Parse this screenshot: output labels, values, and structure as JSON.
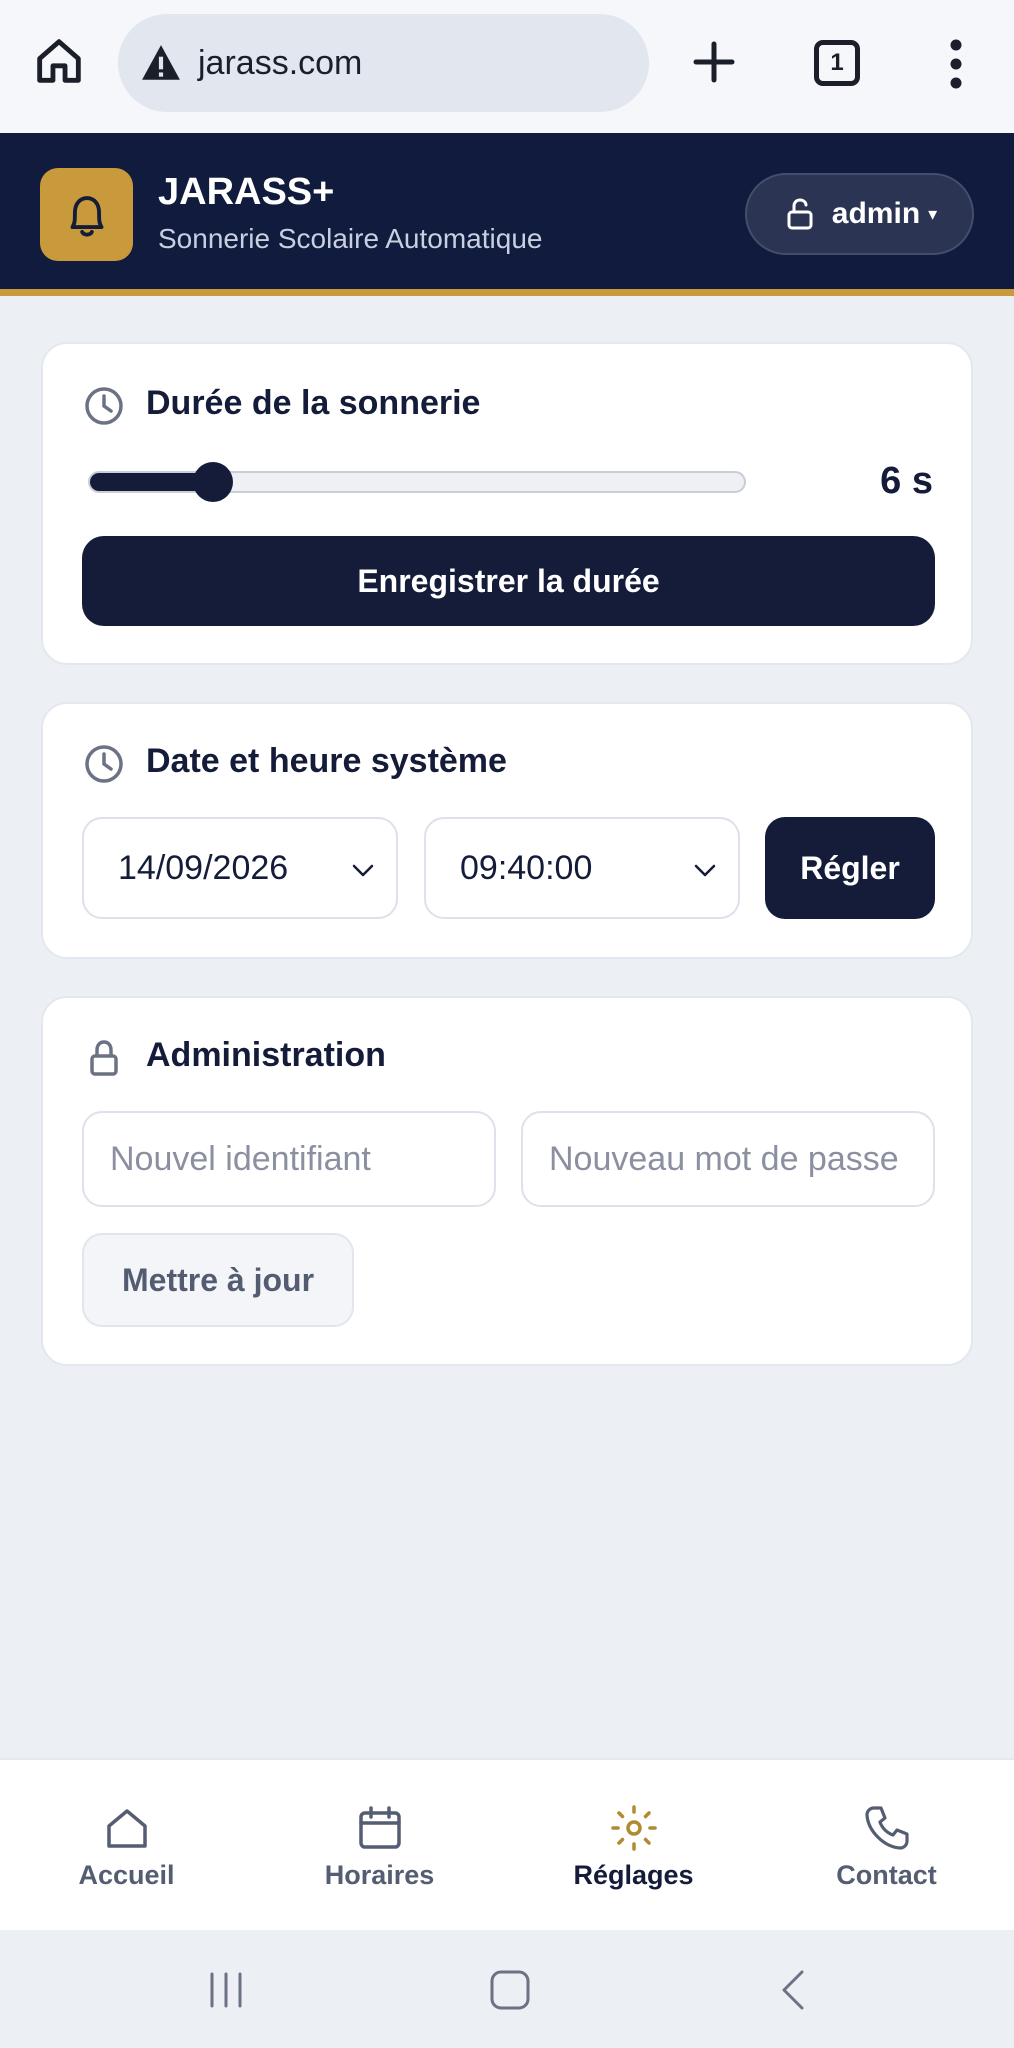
{
  "browser": {
    "url": "jarass.com",
    "tab_count": "1"
  },
  "header": {
    "title": "JARASS+",
    "subtitle": "Sonnerie Scolaire Automatique",
    "user_label": "admin",
    "user_caret": "▾"
  },
  "duration_card": {
    "title": "Durée de la sonnerie",
    "value": 6,
    "value_label": "6 s",
    "slider_fraction": 0.19,
    "save_label": "Enregistrer la durée"
  },
  "datetime_card": {
    "title": "Date et heure système",
    "date_value": "14/09/2026",
    "time_value": "09:40:00",
    "set_label": "Régler"
  },
  "admin_card": {
    "title": "Administration",
    "username_placeholder": "Nouvel identifiant",
    "password_placeholder": "Nouveau mot de passe",
    "update_label": "Mettre à jour"
  },
  "bottom_nav": {
    "items": [
      {
        "label": "Accueil",
        "icon": "home-icon",
        "active": false
      },
      {
        "label": "Horaires",
        "icon": "calendar-icon",
        "active": false
      },
      {
        "label": "Réglages",
        "icon": "sun-settings-icon",
        "active": true
      },
      {
        "label": "Contact",
        "icon": "phone-icon",
        "active": false
      }
    ]
  },
  "colors": {
    "navy": "#141c3a",
    "gold": "#c99a3c",
    "background": "#eceff4"
  }
}
